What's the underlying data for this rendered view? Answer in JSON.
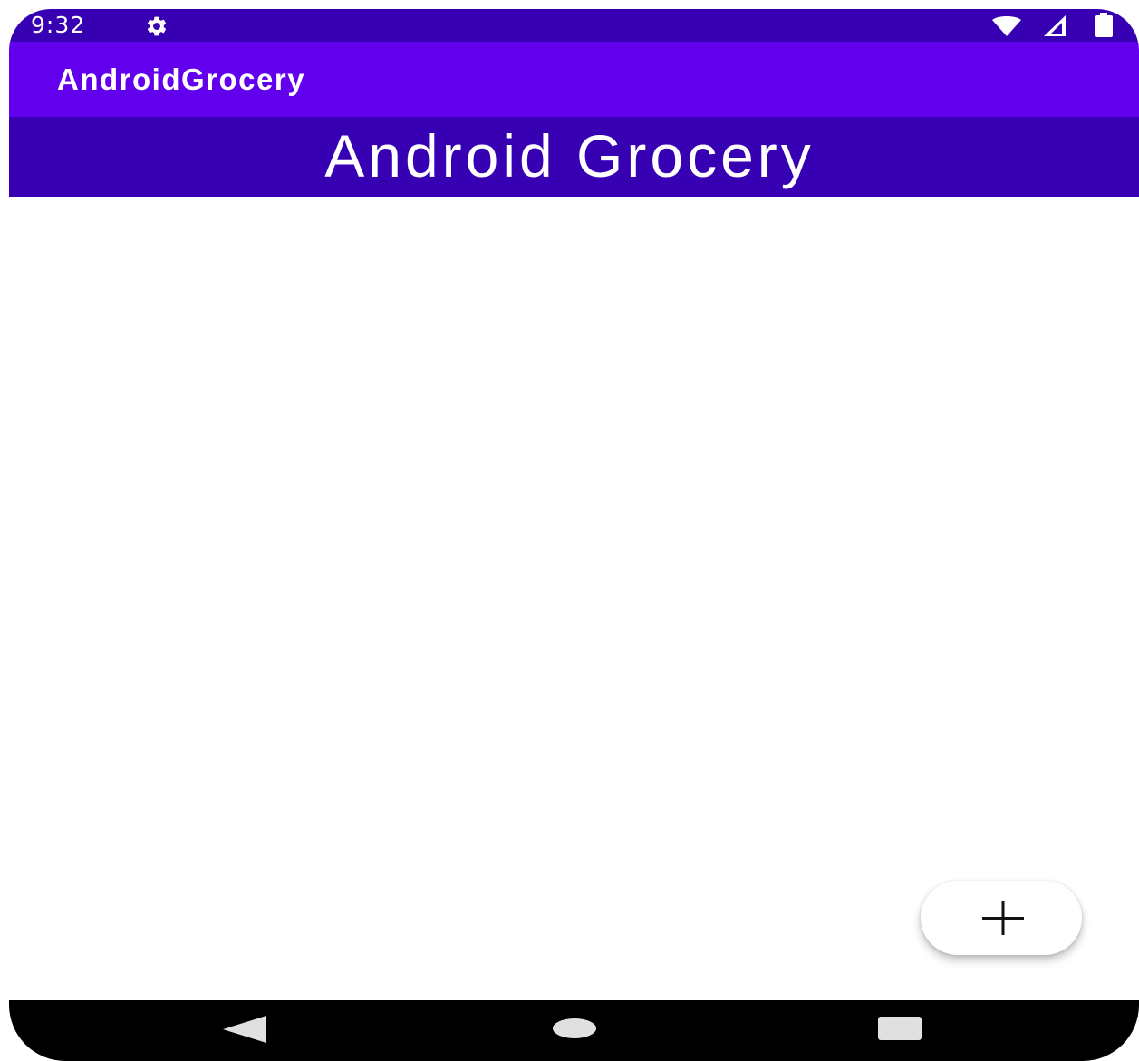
{
  "status_bar": {
    "time": "9:32",
    "icons": [
      "settings-icon",
      "wifi-icon",
      "signal-icon",
      "battery-icon"
    ]
  },
  "app_bar": {
    "title": "AndroidGrocery"
  },
  "header": {
    "title": "Android Grocery"
  },
  "fab": {
    "icon": "plus-icon"
  },
  "nav_bar": {
    "buttons": [
      "back-icon",
      "home-icon",
      "recents-icon"
    ]
  },
  "colors": {
    "primary": "#6200ee",
    "primary_dark": "#3700b3",
    "nav_bar": "#000000",
    "background": "#ffffff",
    "on_primary": "#ffffff"
  }
}
